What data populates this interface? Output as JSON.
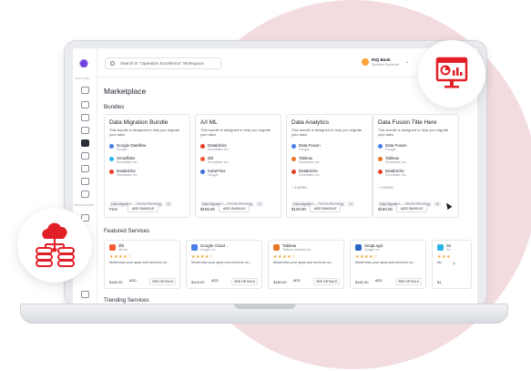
{
  "colors": {
    "accent": "#e21f26",
    "brand": "#6d3de0",
    "star": "#f0a12c",
    "bg_circle": "#f3dcdf"
  },
  "sidebar": {
    "section_label": "EXPLORE",
    "section_label2": "INTEGRATIONS"
  },
  "search": {
    "placeholder": "Search in \"Operation Excellence\" Workspace"
  },
  "org": {
    "name": "INQ Bank",
    "subtitle": "Operation Excellence"
  },
  "page": {
    "title": "Marketplace"
  },
  "bundles_section": {
    "title": "Bundles"
  },
  "bundles": [
    {
      "title": "Data Migration Bundle",
      "desc": "This bundle is designed to help you migrate your data",
      "items": [
        {
          "name": "Google Dataflow",
          "vendor": "Google",
          "icon": "google-dataflow-icon",
          "color": "#4a7fe9"
        },
        {
          "name": "Snowflake",
          "vendor": "Snowflake Inc.",
          "icon": "snowflake-icon",
          "color": "#29b5e8"
        },
        {
          "name": "Databricks",
          "vendor": "Snowflake Inc.",
          "icon": "databricks-icon",
          "color": "#e5402a"
        }
      ],
      "more": "",
      "tags": [
        "Data Migration",
        "Display Reporting",
        "+3"
      ],
      "price": "Free",
      "button": "ADD BUNDLE"
    },
    {
      "title": "A/I ML",
      "desc": "This bundle is designed to help you migrate your data",
      "items": [
        {
          "name": "Databricks",
          "vendor": "Snowflake Inc.",
          "icon": "databricks-icon",
          "color": "#e5402a"
        },
        {
          "name": "dbt",
          "vendor": "Snowflake Inc.",
          "icon": "dbt-icon",
          "color": "#f25b34"
        },
        {
          "name": "KubeFlow",
          "vendor": "Google",
          "icon": "kubeflow-icon",
          "color": "#3a6fd8"
        }
      ],
      "more": "",
      "tags": [
        "Data Migration",
        "Display Reporting",
        "+2"
      ],
      "price": "$156.00",
      "button": "ADD BUNDLE"
    },
    {
      "title": "Data Analytics",
      "desc": "This bundle is designed to help you migrate your data",
      "items": [
        {
          "name": "Data Fusion",
          "vendor": "Google",
          "icon": "data-fusion-icon",
          "color": "#4a7fe9"
        },
        {
          "name": "Tableau",
          "vendor": "Snowflake Inc.",
          "icon": "tableau-icon",
          "color": "#e97627"
        },
        {
          "name": "Databricks",
          "vendor": "Snowflake Inc.",
          "icon": "databricks-icon",
          "color": "#e5402a"
        }
      ],
      "more": "+ 4 MORE...",
      "tags": [
        "Data Migration",
        "Display Reporting",
        "+3"
      ],
      "price": "$136.00",
      "button": "ADD BUNDLE"
    },
    {
      "title": "Data Fusion Title Here",
      "desc": "This bundle is designed to help you migrate your data",
      "items": [
        {
          "name": "Data Fusion",
          "vendor": "Google",
          "icon": "data-fusion-icon",
          "color": "#4a7fe9"
        },
        {
          "name": "Tableau",
          "vendor": "Snowflake Inc.",
          "icon": "tableau-icon",
          "color": "#e97627"
        },
        {
          "name": "Databricks",
          "vendor": "Snowflake Inc.",
          "icon": "databricks-icon",
          "color": "#e5402a"
        }
      ],
      "more": "+ 4 MORE...",
      "tags": [
        "Data Migration",
        "Display Reporting",
        "+8"
      ],
      "price": "$190.00",
      "button": "ADD BUNDLE"
    }
  ],
  "featured_section": {
    "title": "Featured Services"
  },
  "services": [
    {
      "name": "dbt",
      "vendor": "dbt Inc.",
      "icon": "dbt-icon",
      "color": "#f25b34",
      "stars": "★★★★☆",
      "desc": "Modernise your apps and services on...",
      "price": "$182.00",
      "add": "ADD",
      "details": "SEE DETAILS"
    },
    {
      "name": "Google Cloud ...",
      "vendor": "Google Inc.",
      "icon": "google-cloud-icon",
      "color": "#4a7fe9",
      "stars": "★★★★☆",
      "desc": "Modernise your apps and services on...",
      "price": "$104.00",
      "add": "ADD",
      "details": "SEE DETAILS"
    },
    {
      "name": "Tableau",
      "vendor": "Tableau software Us.",
      "icon": "tableau-icon",
      "color": "#e97627",
      "stars": "★★★★☆",
      "desc": "Modernise your apps and services on...",
      "price": "$180.00",
      "add": "ADD",
      "details": "SEE DETAILS"
    },
    {
      "name": "SnapLogic",
      "vendor": "Google Inc.",
      "icon": "snaplogic-icon",
      "color": "#2a65c9",
      "stars": "★★★★☆",
      "desc": "Modernise your apps and services on...",
      "price": "$182.00",
      "add": "ADD",
      "details": "SEE DETAILS"
    },
    {
      "name": "Sn",
      "vendor": "Go",
      "icon": "snowflake-icon",
      "color": "#29b5e8",
      "stars": "★★★",
      "desc": "Mo",
      "price": "$1",
      "add": "",
      "details": ""
    }
  ],
  "trending_section": {
    "title": "Trending Services"
  }
}
